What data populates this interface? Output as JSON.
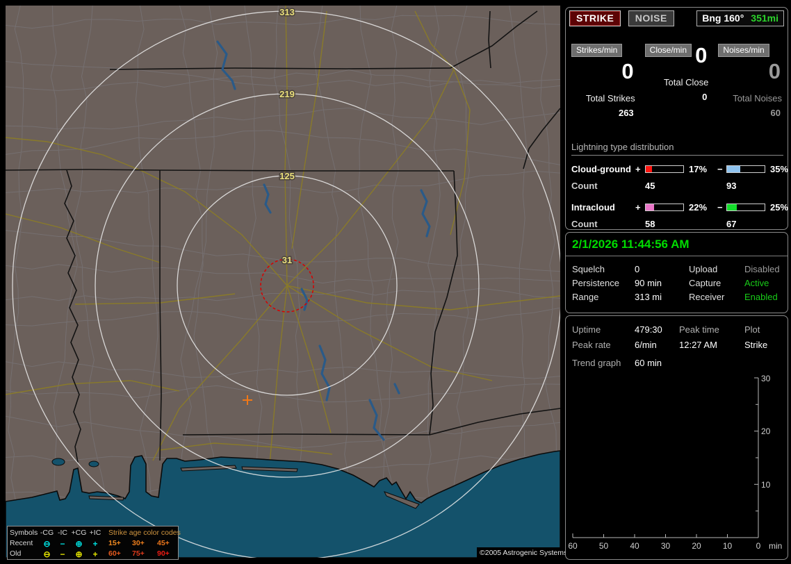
{
  "header": {
    "strike": "STRIKE",
    "noise": "NOISE",
    "bearing": "Bng 160°",
    "range": "351mi"
  },
  "counters": [
    {
      "badge": "Strikes/min",
      "rate": "0",
      "total_label": "Total Strikes",
      "total": "263"
    },
    {
      "badge": "Close/min",
      "rate": "0",
      "total_label": "Total Close",
      "total": "0"
    },
    {
      "badge": "Noises/min",
      "rate": "0",
      "total_label": "Total Noises",
      "total": "60"
    }
  ],
  "distribution": {
    "title": "Lightning type distribution",
    "count_label": "Count",
    "rows": [
      {
        "label": "Cloud-ground",
        "plus_sign": "+",
        "minus_sign": "−",
        "plus_pct": "17%",
        "plus_width": "17%",
        "plus_color": "#ff1510",
        "plus_count": "45",
        "minus_pct": "35%",
        "minus_width": "35%",
        "minus_color": "#8fc3ef",
        "minus_count": "93"
      },
      {
        "label": "Intracloud",
        "plus_sign": "+",
        "minus_sign": "−",
        "plus_pct": "22%",
        "plus_width": "22%",
        "plus_color": "#ea76c8",
        "plus_count": "58",
        "minus_pct": "25%",
        "minus_width": "25%",
        "minus_color": "#14dd2c",
        "minus_count": "67"
      }
    ]
  },
  "clock": {
    "datetime": "2/1/2026 11:44:56 AM",
    "rows": [
      {
        "l1": "Squelch",
        "v1": "0",
        "l2": "Upload",
        "v2": "Disabled",
        "v2_color": "#9c9c9c"
      },
      {
        "l1": "Persistence",
        "v1": "90 min",
        "l2": "Capture",
        "v2": "Active",
        "v2_color": "#18cc18"
      },
      {
        "l1": "Range",
        "v1": "313 mi",
        "l2": "Receiver",
        "v2": "Enabled",
        "v2_color": "#18cc18"
      }
    ]
  },
  "stats": {
    "uptime_label": "Uptime",
    "uptime": "479:30",
    "peaktime_label": "Peak time",
    "plot_label": "Plot",
    "peakrate_label": "Peak rate",
    "peakrate": "6/min",
    "peaktime": "12:27 AM",
    "plot": "Strike",
    "trend_label": "Trend graph",
    "trend_value": "60 min"
  },
  "trend_graph": {
    "type": "line",
    "series": [],
    "y_labels": [
      "30",
      "20",
      "10"
    ],
    "x_labels": [
      "60",
      "50",
      "40",
      "30",
      "20",
      "10",
      "0"
    ],
    "x_unit": "min",
    "y_range": [
      0,
      30
    ],
    "x_range_minutes_ago": [
      60,
      0
    ]
  },
  "map": {
    "rings": [
      {
        "label": "313"
      },
      {
        "label": "219"
      },
      {
        "label": "125"
      },
      {
        "label": "31"
      }
    ],
    "ring_label_color": "#eadf7b",
    "land_color": "#6b605b",
    "water_color": "#14526b",
    "copyright": "©2005 Astrogenic Systems"
  },
  "legend": {
    "symbols_header": "Symbols",
    "cols": [
      "-CG",
      "-IC",
      "+CG",
      "+IC"
    ],
    "age_header": "Strike age color codes",
    "recent_label": "Recent",
    "old_label": "Old",
    "sym_minus_circle": "⊖",
    "sym_minus": "−",
    "sym_plus_circle": "⊕",
    "sym_plus": "+",
    "recent_color": "#00dede",
    "old_color": "#e0e000",
    "ages_recent": [
      {
        "t": "15+",
        "c": "#f08a20"
      },
      {
        "t": "30+",
        "c": "#ee7e1c"
      },
      {
        "t": "45+",
        "c": "#ec761b"
      }
    ],
    "ages_old": [
      {
        "t": "60+",
        "c": "#e65a1e"
      },
      {
        "t": "75+",
        "c": "#e13c1c"
      },
      {
        "t": "90+",
        "c": "#ef1c14"
      }
    ]
  }
}
